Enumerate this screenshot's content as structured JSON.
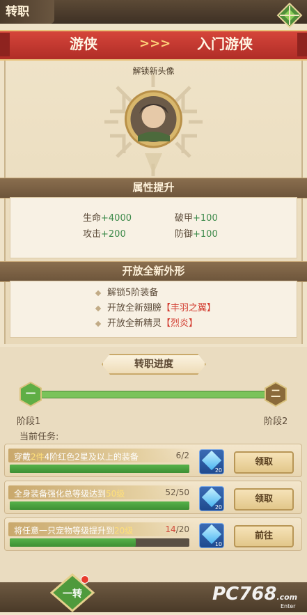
{
  "header": {
    "title": "转职"
  },
  "banner": {
    "from_class": "游侠",
    "to_class": "入门游侠",
    "arrows": ">>>"
  },
  "unlock": {
    "label": "解锁新头像"
  },
  "attributes": {
    "title": "属性提升",
    "items": [
      {
        "name": "生命",
        "value": "+4000"
      },
      {
        "name": "破甲",
        "value": "+100"
      },
      {
        "name": "攻击",
        "value": "+200"
      },
      {
        "name": "防御",
        "value": "+100"
      }
    ]
  },
  "new_look": {
    "title": "开放全新外形",
    "items": [
      {
        "text": "解锁5阶装备",
        "highlight": ""
      },
      {
        "text": "开放全新翅膀",
        "highlight": "【丰羽之翼】"
      },
      {
        "text": "开放全新精灵",
        "highlight": "【烈炎】"
      }
    ]
  },
  "progress": {
    "title": "转职进度",
    "stage1_node": "一",
    "stage2_node": "二",
    "stage1_label": "阶段1",
    "stage2_label": "阶段2",
    "fill": 1.0
  },
  "tasks": {
    "label": "当前任务:",
    "items": [
      {
        "pre": "穿戴",
        "hl1": "2件",
        "mid": "4阶红色2星及以上的装备",
        "hl2": "",
        "post": "",
        "done": "6",
        "total": "/2",
        "done_red": false,
        "progress": 1.0,
        "reward_count": "20",
        "action": "领取"
      },
      {
        "pre": "全身装备强化总等级达到",
        "hl1": "50级",
        "mid": "",
        "hl2": "",
        "post": "",
        "done": "52",
        "total": "/50",
        "done_red": false,
        "progress": 1.0,
        "reward_count": "20",
        "action": "领取"
      },
      {
        "pre": "将任意一只宠物等级提升到",
        "hl1": "20级",
        "mid": "",
        "hl2": "",
        "post": "",
        "done": "14",
        "total": "/20",
        "done_red": true,
        "progress": 0.7,
        "reward_count": "10",
        "action": "前往"
      }
    ]
  },
  "bottom": {
    "tab_label": "一转"
  },
  "watermark": {
    "text": "PC768",
    "domain": ".com",
    "sub": "Enter"
  },
  "colors": {
    "banner_red": "#c0352e",
    "progress_green": "#7ac35a",
    "highlight_red": "#d23a2e",
    "stat_green": "#3d8a4a"
  }
}
